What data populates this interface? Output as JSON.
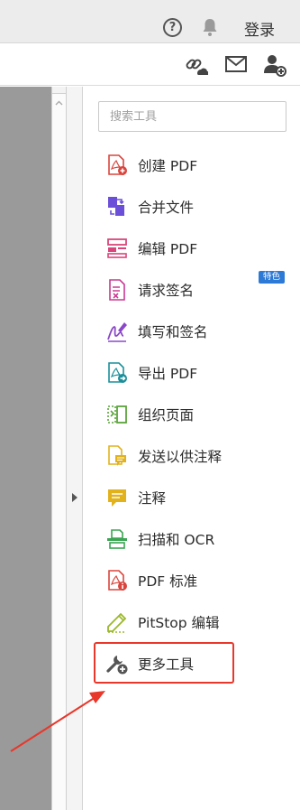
{
  "header": {
    "help_icon_glyph": "?",
    "login_label": "登录"
  },
  "search": {
    "placeholder": "搜索工具"
  },
  "tools": [
    {
      "label": "创建 PDF",
      "icon": "create-pdf-icon",
      "color": "#d9453d"
    },
    {
      "label": "合并文件",
      "icon": "combine-files-icon",
      "color": "#6b4fd8"
    },
    {
      "label": "编辑 PDF",
      "icon": "edit-pdf-icon",
      "color": "#d9457a"
    },
    {
      "label": "请求签名",
      "icon": "request-signature-icon",
      "color": "#c93a93",
      "badge": "特色"
    },
    {
      "label": "填写和签名",
      "icon": "fill-sign-icon",
      "color": "#8a48c8"
    },
    {
      "label": "导出 PDF",
      "icon": "export-pdf-icon",
      "color": "#1a8f9a"
    },
    {
      "label": "组织页面",
      "icon": "organize-pages-icon",
      "color": "#5ba33b"
    },
    {
      "label": "发送以供注释",
      "icon": "send-for-comments-icon",
      "color": "#e2b21d"
    },
    {
      "label": "注释",
      "icon": "comment-icon",
      "color": "#e2b21d"
    },
    {
      "label": "扫描和 OCR",
      "icon": "scan-ocr-icon",
      "color": "#3aa552"
    },
    {
      "label": "PDF 标准",
      "icon": "pdf-standards-icon",
      "color": "#d9453d"
    },
    {
      "label": "PitStop 编辑",
      "icon": "pitstop-edit-icon",
      "color": "#9ab82a"
    },
    {
      "label": "更多工具",
      "icon": "more-tools-icon",
      "color": "#555555"
    }
  ],
  "colors": {
    "highlight": "#e8372b",
    "badge": "#2d7ad6"
  }
}
